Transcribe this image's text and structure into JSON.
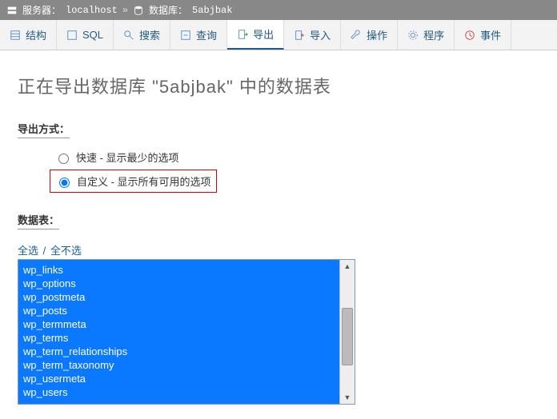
{
  "breadcrumb": {
    "server_label": "服务器：",
    "server_value": "localhost",
    "db_label": "数据库：",
    "db_value": "5abjbak"
  },
  "tabs": [
    {
      "label": "结构"
    },
    {
      "label": "SQL"
    },
    {
      "label": "搜索"
    },
    {
      "label": "查询"
    },
    {
      "label": "导出"
    },
    {
      "label": "导入"
    },
    {
      "label": "操作"
    },
    {
      "label": "程序"
    },
    {
      "label": "事件"
    }
  ],
  "page_title": "正在导出数据库 \"5abjbak\" 中的数据表",
  "export_method": {
    "section": "导出方式：",
    "quick": "快速 - 显示最少的选项",
    "custom": "自定义 - 显示所有可用的选项"
  },
  "tables": {
    "section": "数据表：",
    "select_all": "全选",
    "unselect_all": "全不选",
    "items": [
      "wp_links",
      "wp_options",
      "wp_postmeta",
      "wp_posts",
      "wp_termmeta",
      "wp_terms",
      "wp_term_relationships",
      "wp_term_taxonomy",
      "wp_usermeta",
      "wp_users"
    ]
  }
}
